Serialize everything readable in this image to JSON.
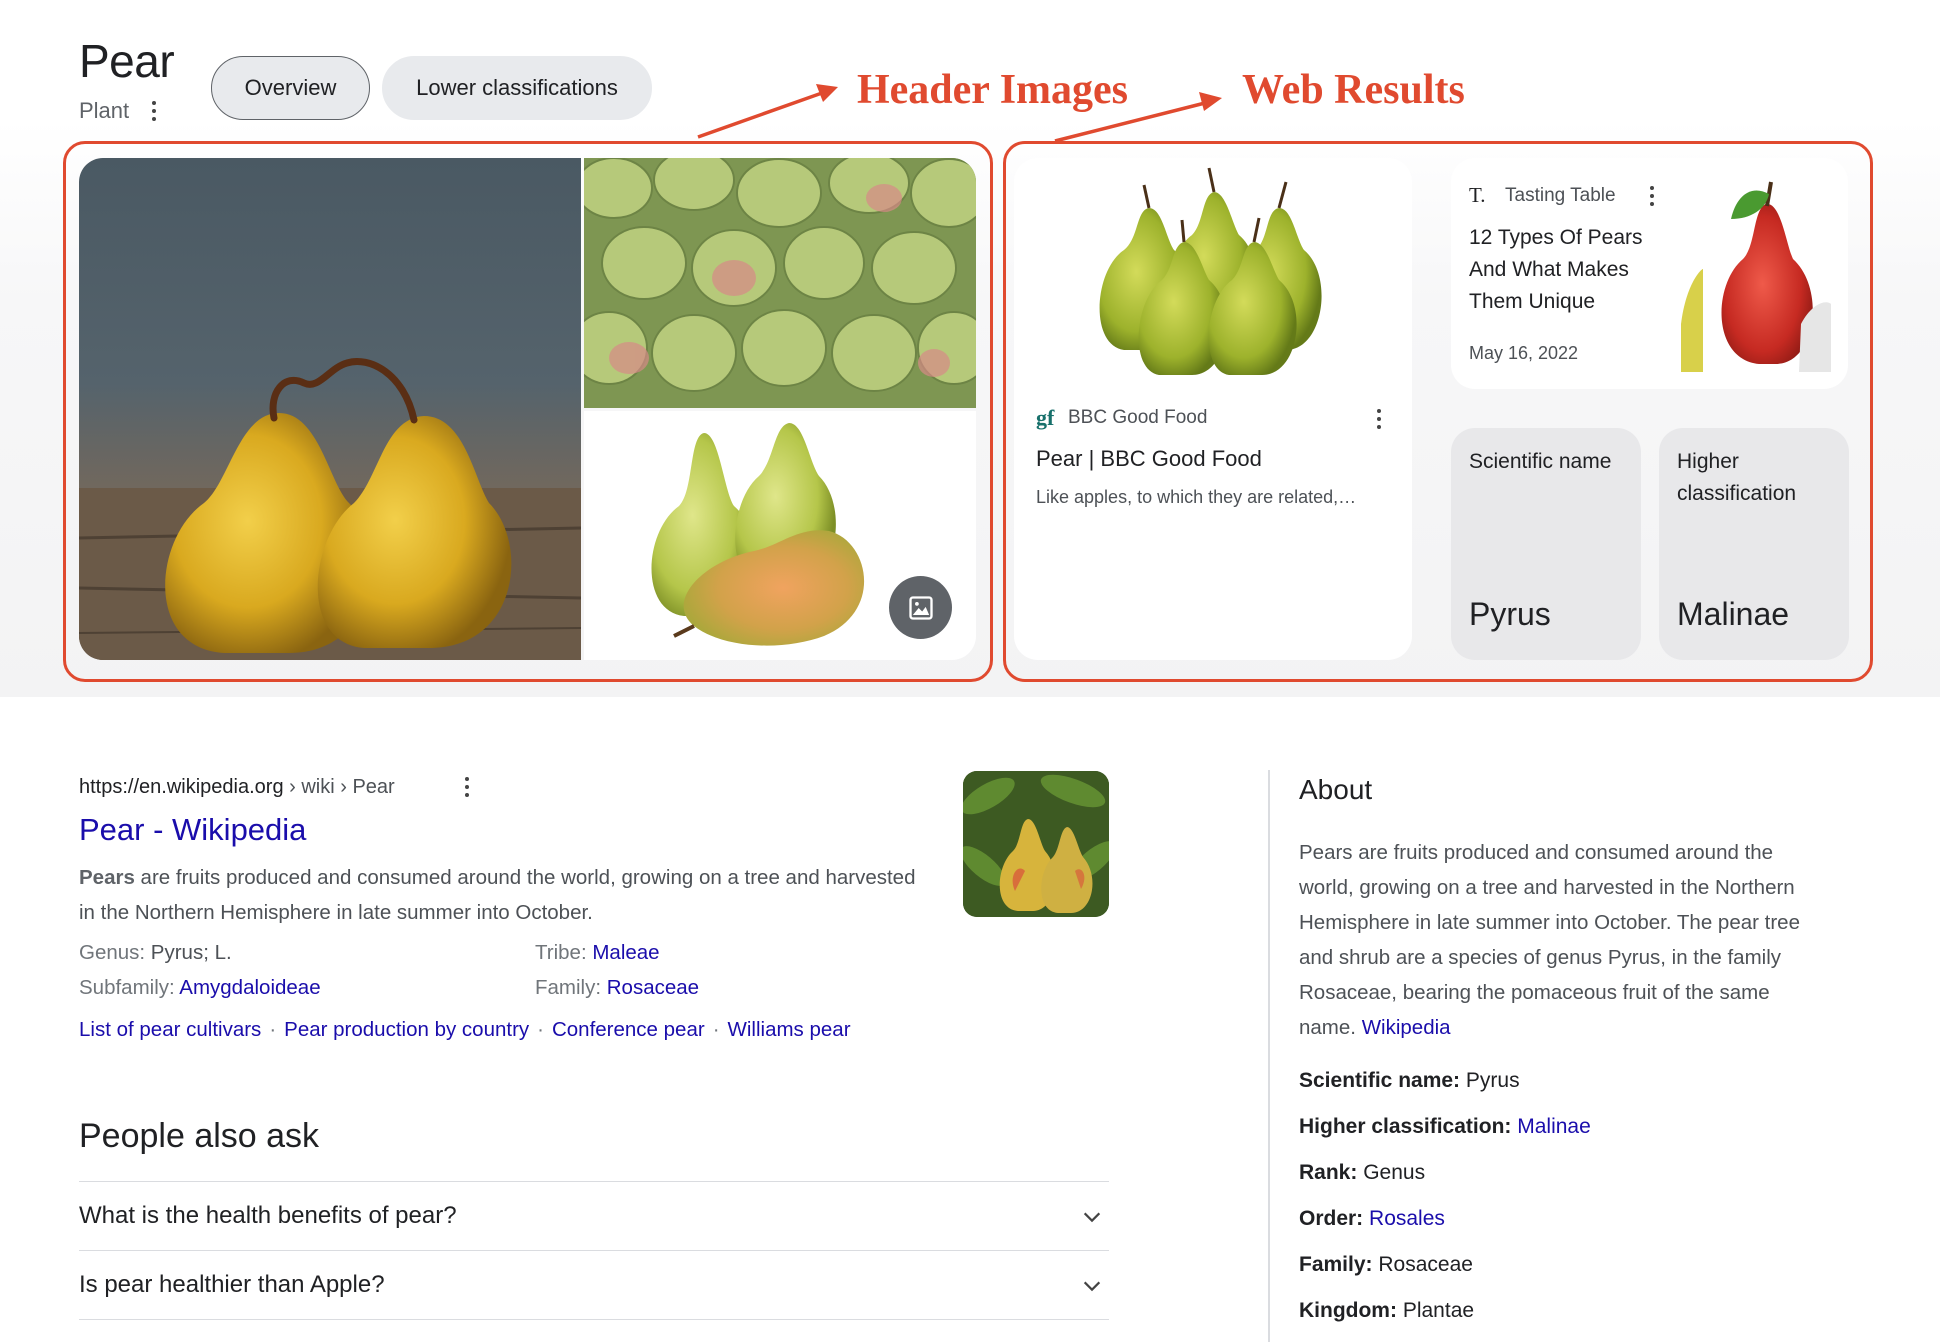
{
  "entity": {
    "title": "Pear",
    "subtitle": "Plant"
  },
  "chips": {
    "overview": "Overview",
    "lower": "Lower classifications"
  },
  "annotations": {
    "header_images": "Header Images",
    "web_results": "Web Results"
  },
  "web_results": {
    "bbc": {
      "logo": "gf",
      "source": "BBC Good Food",
      "title": "Pear | BBC Good Food",
      "snippet": "Like apples, to which they are related,…"
    },
    "tasting_table": {
      "logo": "T.",
      "source": "Tasting Table",
      "title": "12 Types Of Pears And What Makes Them Unique",
      "date": "May 16, 2022"
    }
  },
  "facts_cards": [
    {
      "label": "Scientific name",
      "value": "Pyrus"
    },
    {
      "label": "Higher classification",
      "value": "Malinae"
    }
  ],
  "wiki_result": {
    "cite_domain": "https://en.wikipedia.org",
    "cite_path": " › wiki › Pear",
    "title": "Pear - Wikipedia",
    "snippet_bold": "Pears",
    "snippet_rest": " are fruits produced and consumed around the world, growing on a tree and harvested in the Northern Hemisphere in late summer into October.",
    "attributes": {
      "genus_label": "Genus: ",
      "genus_value": "Pyrus; L.",
      "tribe_label": "Tribe: ",
      "tribe_value": "Maleae",
      "subfamily_label": "Subfamily: ",
      "subfamily_value": "Amygdaloideae",
      "family_label": "Family: ",
      "family_value": "Rosaceae"
    },
    "sitelinks": [
      "List of pear cultivars",
      "Pear production by country",
      "Conference pear",
      "Williams pear"
    ]
  },
  "people_also_ask": {
    "title": "People also ask",
    "questions": [
      "What is the health benefits of pear?",
      "Is pear healthier than Apple?"
    ]
  },
  "about": {
    "title": "About",
    "text": "Pears are fruits produced and consumed around the world, growing on a tree and harvested in the Northern Hemisphere in late summer into October. The pear tree and shrub are a species of genus Pyrus, in the family Rosaceae, bearing the pomaceous fruit of the same name.",
    "source_link": "Wikipedia",
    "facts": [
      {
        "label": "Scientific name:",
        "value": "Pyrus",
        "link": false
      },
      {
        "label": "Higher classification:",
        "value": "Malinae",
        "link": true
      },
      {
        "label": "Rank:",
        "value": "Genus",
        "link": false
      },
      {
        "label": "Order:",
        "value": "Rosales",
        "link": true
      },
      {
        "label": "Family:",
        "value": "Rosaceae",
        "link": false
      },
      {
        "label": "Kingdom:",
        "value": "Plantae",
        "link": false
      }
    ]
  },
  "colors": {
    "link": "#1a0dab",
    "annotation": "#e04a2f",
    "chip_bg": "#e8eaed",
    "fact_card_bg": "#e8e8ea"
  },
  "icons": [
    "more-vert-icon",
    "image-icon",
    "chevron-down-icon"
  ]
}
